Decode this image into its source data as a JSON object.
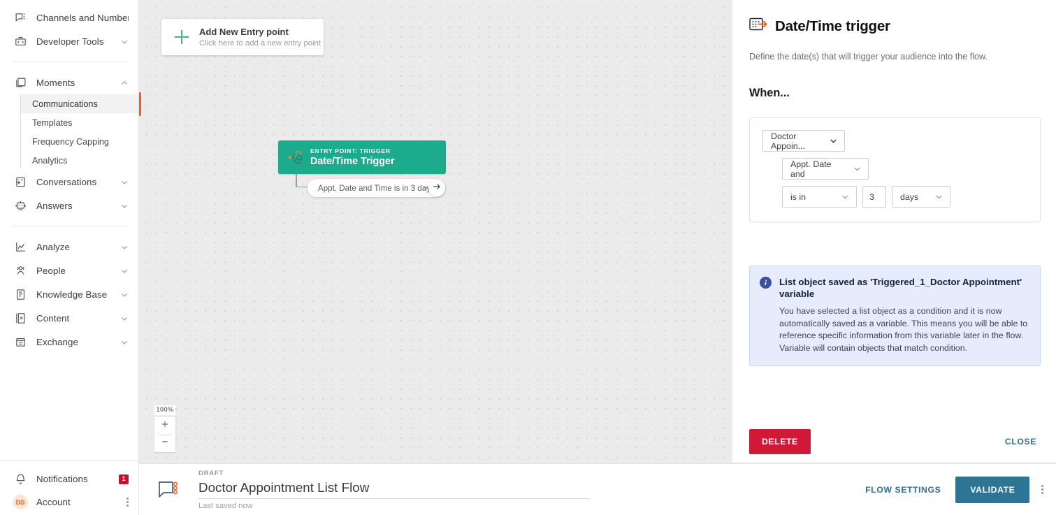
{
  "sidebar": {
    "items": [
      {
        "label": "Channels and Numbers",
        "icon": "chat-dots-icon",
        "expandable": false
      },
      {
        "label": "Developer Tools",
        "icon": "code-toolbox-icon",
        "expandable": true
      },
      {
        "label": "Moments",
        "icon": "moments-icon",
        "expandable": true,
        "expanded": true
      },
      {
        "label": "Conversations",
        "icon": "conversations-icon",
        "expandable": true
      },
      {
        "label": "Answers",
        "icon": "answers-bot-icon",
        "expandable": true
      },
      {
        "label": "Analyze",
        "icon": "analyze-chart-icon",
        "expandable": true
      },
      {
        "label": "People",
        "icon": "people-icon",
        "expandable": true
      },
      {
        "label": "Knowledge Base",
        "icon": "knowledge-base-icon",
        "expandable": true
      },
      {
        "label": "Content",
        "icon": "content-icon",
        "expandable": true
      },
      {
        "label": "Exchange",
        "icon": "exchange-icon",
        "expandable": true
      }
    ],
    "moments_subitems": [
      {
        "label": "Communications",
        "active": true
      },
      {
        "label": "Templates",
        "active": false
      },
      {
        "label": "Frequency Capping",
        "active": false
      },
      {
        "label": "Analytics",
        "active": false
      }
    ],
    "notifications": {
      "label": "Notifications",
      "icon": "bell-icon",
      "badge": "1"
    },
    "account": {
      "label": "Account",
      "initials": "DS",
      "menu_icon": "kebab-menu-icon"
    }
  },
  "canvas": {
    "add_entry": {
      "title": "Add New Entry point",
      "subtitle": "Click here to add a new entry point",
      "icon": "plus-icon"
    },
    "trigger_node": {
      "kicker": "ENTRY POINT: TRIGGER",
      "title": "Date/Time Trigger",
      "icon": "trigger-flow-icon",
      "color": "#1dab8e"
    },
    "condition_pill": {
      "label": "Appt. Date and Time is in 3 days",
      "arrow_icon": "arrow-right-icon"
    },
    "zoom": {
      "level": "100%",
      "in_label": "+",
      "out_label": "−"
    }
  },
  "panel": {
    "icon": "date-time-trigger-icon",
    "title": "Date/Time trigger",
    "description": "Define the date(s) that will trigger your audience into the flow.",
    "when_label": "When...",
    "condition": {
      "object_select": {
        "value": "Doctor Appoin...",
        "icon": "chevron-down-icon"
      },
      "attribute_select": {
        "value": "Appt. Date and",
        "icon": "chevron-down-icon"
      },
      "operator_select": {
        "value": "is in",
        "icon": "chevron-down-icon"
      },
      "amount_input": {
        "value": "3"
      },
      "unit_select": {
        "value": "days",
        "icon": "chevron-down-icon"
      }
    },
    "info": {
      "icon": "info-icon",
      "title": "List object saved as 'Triggered_1_Doctor Appointment' variable",
      "text": "You have selected a list object as a condition and it is now automatically saved as a variable. This means you will be able to reference specific information from this variable later in the flow. Variable will contain objects that match condition."
    },
    "delete_label": "DELETE",
    "close_label": "CLOSE"
  },
  "bottom_bar": {
    "flow_icon": "flow-node-icon",
    "status": "DRAFT",
    "name": "Doctor Appointment List Flow",
    "saved": "Last saved now",
    "flow_settings_label": "FLOW SETTINGS",
    "validate_label": "VALIDATE",
    "menu_icon": "kebab-menu-icon"
  },
  "colors": {
    "accent_teal": "#1dab8e",
    "accent_orange": "#e8622c",
    "danger_red": "#d01936",
    "primary_blue": "#2d7596",
    "info_blue": "#3c4fa0"
  }
}
